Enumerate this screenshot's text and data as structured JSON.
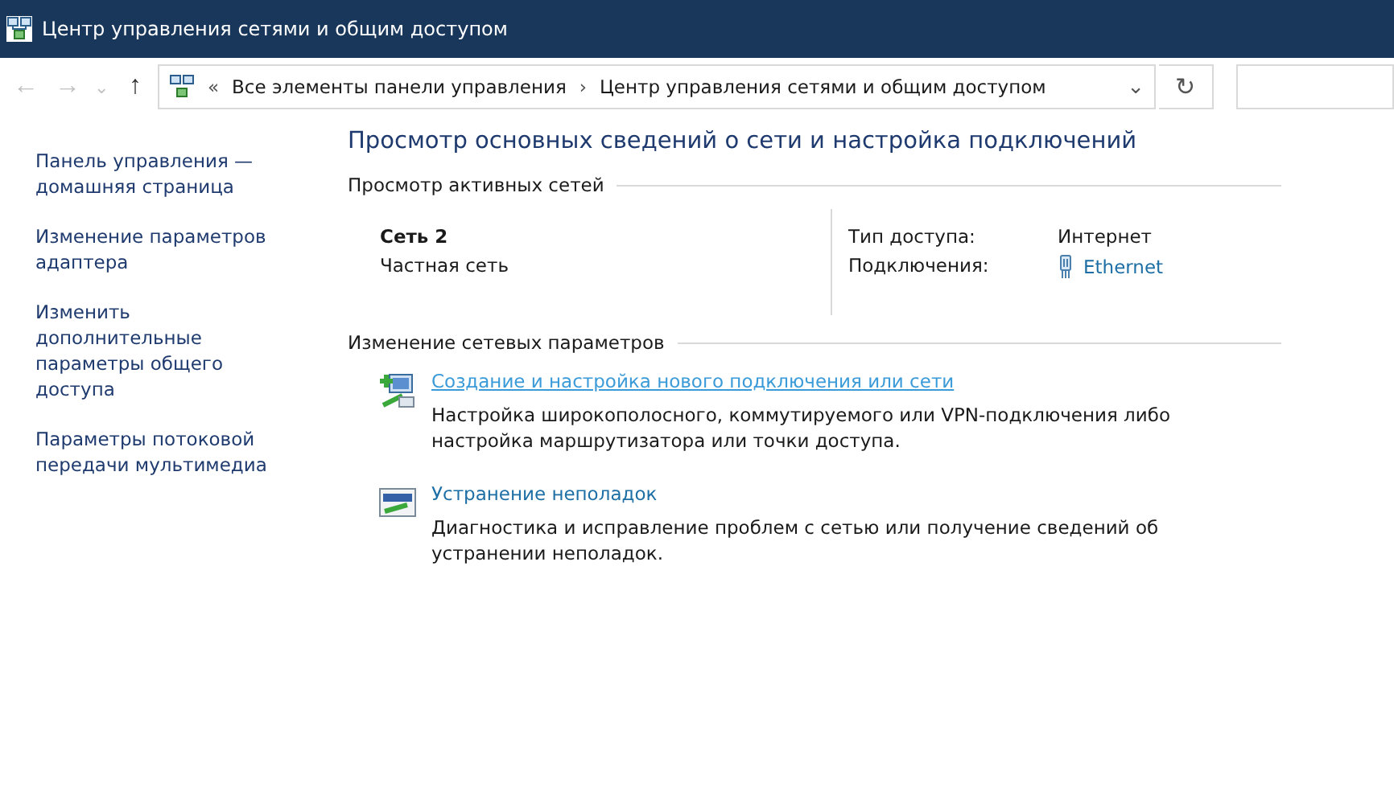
{
  "window": {
    "title": "Центр управления сетями и общим доступом"
  },
  "nav": [
    {
      "kind": "back",
      "glyph": "←",
      "disabled": true
    },
    {
      "kind": "forward",
      "glyph": "→",
      "disabled": true
    },
    {
      "kind": "recent",
      "glyph": "⌄",
      "disabled": true
    },
    {
      "kind": "up",
      "glyph": "↑",
      "disabled": false
    }
  ],
  "address": {
    "overflow": "«",
    "crumbs": [
      "Все элементы панели управления",
      "Центр управления сетями и общим доступом"
    ],
    "separator": "›",
    "dropdown": "⌄",
    "refresh": "↻"
  },
  "sidebar": {
    "items": [
      "Панель управления — домашняя страница",
      "Изменение параметров адаптера",
      "Изменить дополнительные параметры общего доступа",
      "Параметры потоковой передачи мультимедиа"
    ]
  },
  "heading": "Просмотр основных сведений о сети и настройка подключений",
  "active_networks": {
    "title": "Просмотр активных сетей",
    "name": "Сеть 2",
    "category": "Частная сеть",
    "access_label": "Тип доступа:",
    "access_value": "Интернет",
    "connections_label": "Подключения:",
    "connection": "Ethernet"
  },
  "change_settings": {
    "title": "Изменение сетевых параметров",
    "tasks": [
      {
        "kind": "new-connection",
        "link": "Создание и настройка нового подключения или сети",
        "hovered": true,
        "description": "Настройка широкополосного, коммутируемого или VPN-подключения либо настройка маршрутизатора или точки доступа."
      },
      {
        "kind": "troubleshoot",
        "link": "Устранение неполадок",
        "hovered": false,
        "description": "Диагностика и исправление проблем с сетью или получение сведений об устранении неполадок."
      }
    ]
  }
}
